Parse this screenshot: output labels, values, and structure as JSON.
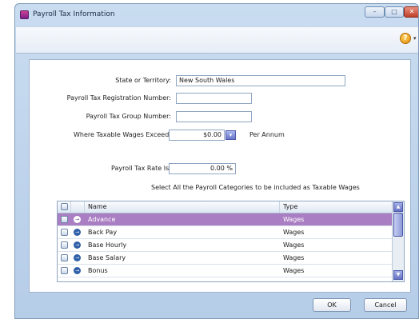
{
  "window": {
    "title": "Payroll Tax Information",
    "controls": {
      "minimize": "–",
      "maximize": "□",
      "close": "✕"
    }
  },
  "toolbar": {
    "help_icon": "?",
    "help_dropdown": "▾"
  },
  "form": {
    "state_label": "State or Territory:",
    "state_value": "New South Wales",
    "registration_label": "Payroll Tax Registration Number:",
    "registration_value": "",
    "group_label": "Payroll Tax Group Number:",
    "group_value": "",
    "threshold_label": "Where Taxable Wages Exceed:",
    "threshold_value": "$0.00",
    "threshold_dropdown": "▾",
    "threshold_period": "Per Annum",
    "rate_label": "Payroll Tax Rate Is:",
    "rate_value": "0.00 %"
  },
  "categories": {
    "instruction": "Select All the Payroll Categories to be included as Taxable Wages",
    "columns": {
      "name": "Name",
      "type": "Type"
    },
    "rows": [
      {
        "name": "Advance",
        "type": "Wages",
        "selected": true
      },
      {
        "name": "Back Pay",
        "type": "Wages",
        "selected": false
      },
      {
        "name": "Base Hourly",
        "type": "Wages",
        "selected": false
      },
      {
        "name": "Base Salary",
        "type": "Wages",
        "selected": false
      },
      {
        "name": "Bonus",
        "type": "Wages",
        "selected": false
      }
    ],
    "row_arrow": "→"
  },
  "scrollbar": {
    "up": "▲",
    "down": "▼"
  },
  "buttons": {
    "ok": "OK",
    "cancel": "Cancel"
  },
  "colors": {
    "selected_row": "#a97ec2",
    "window_frame": "#b6cde8"
  }
}
